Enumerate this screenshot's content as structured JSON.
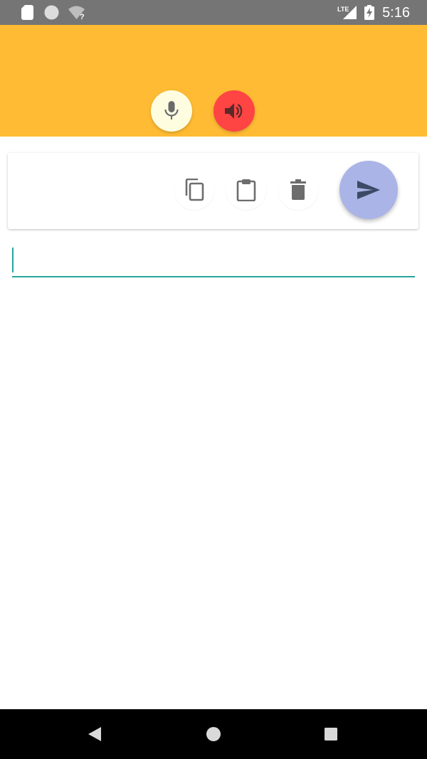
{
  "status_bar": {
    "time": "5:16",
    "network_label": "LTE",
    "icons": [
      "sd-card-icon",
      "circle-icon",
      "wifi-unknown-icon",
      "lte-signal-icon",
      "battery-charging-icon"
    ]
  },
  "header": {
    "color": "#ffbb33",
    "mic_button": {
      "icon": "mic-icon",
      "color": "#fefde0"
    },
    "speaker_button": {
      "icon": "speaker-icon",
      "color": "#ff4444"
    }
  },
  "toolbar": {
    "buttons": [
      {
        "icon": "copy-icon"
      },
      {
        "icon": "clipboard-icon"
      },
      {
        "icon": "trash-icon"
      },
      {
        "icon": "send-icon",
        "color": "#aab4e6"
      }
    ]
  },
  "input": {
    "value": "",
    "placeholder": "",
    "accent_color": "#26a69a"
  },
  "nav_bar": {
    "icons": [
      "back-icon",
      "home-icon",
      "recents-icon"
    ]
  }
}
